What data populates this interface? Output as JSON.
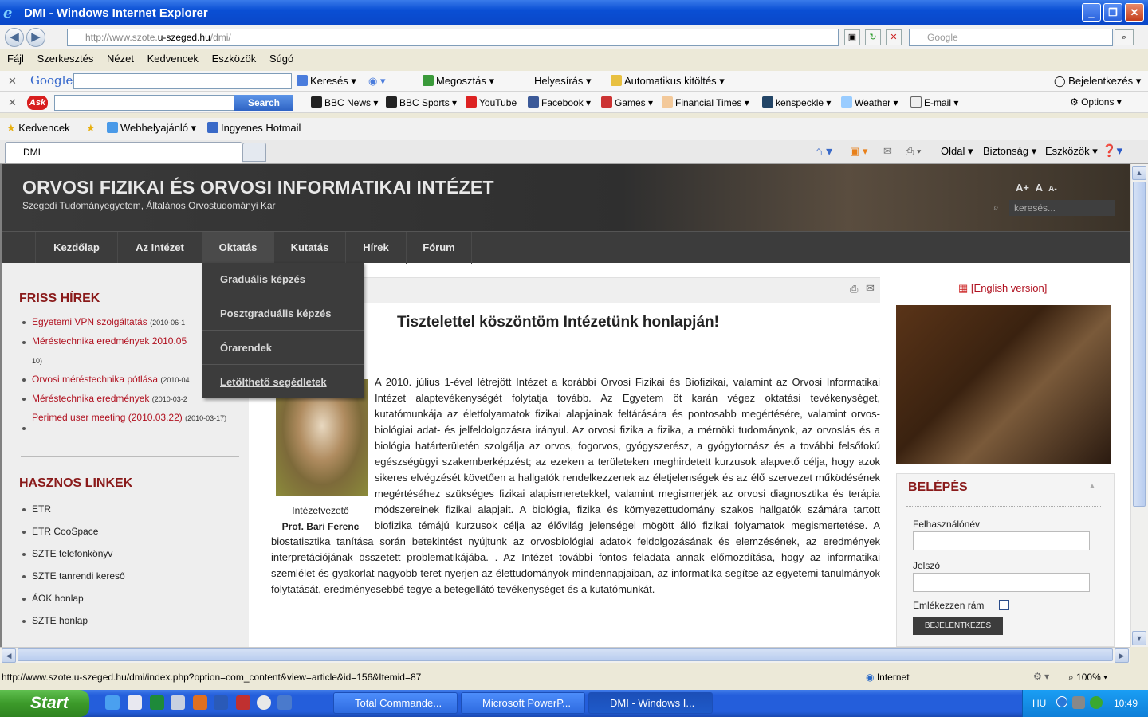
{
  "window": {
    "title": "DMI - Windows Internet Explorer"
  },
  "address": {
    "url_prefix": "http://www.szote.",
    "url_domain": "u-szeged.hu",
    "url_suffix": "/dmi/",
    "search_placeholder": "Google"
  },
  "menu": [
    "Fájl",
    "Szerkesztés",
    "Nézet",
    "Kedvencek",
    "Eszközök",
    "Súgó"
  ],
  "google_toolbar": {
    "logo": "Google",
    "items": [
      "Keresés",
      "Megosztás",
      "Helyesírás",
      "Automatikus kitöltés",
      "Bejelentkezés"
    ]
  },
  "ask_toolbar": {
    "logo": "Ask",
    "search_button": "Search",
    "items": [
      "BBC News",
      "BBC Sports",
      "YouTube",
      "Facebook",
      "Games",
      "Financial Times",
      "kenspeckle",
      "Weather",
      "E-mail",
      "Options"
    ]
  },
  "favorites": {
    "label": "Kedvencek",
    "items": [
      "Webhelyajánló",
      "Ingyenes Hotmail"
    ]
  },
  "tabs": {
    "active": "DMI",
    "commands": [
      "Oldal",
      "Biztonság",
      "Eszközök"
    ]
  },
  "site": {
    "title": "ORVOSI FIZIKAI ÉS ORVOSI INFORMATIKAI INTÉZET",
    "subtitle": "Szegedi Tudományegyetem, Általános Orvostudományi Kar",
    "font_sizes": [
      "A+",
      "A",
      "A-"
    ],
    "search_placeholder": "keresés...",
    "nav": [
      "Kezdőlap",
      "Az Intézet",
      "Oktatás",
      "Kutatás",
      "Hírek",
      "Fórum"
    ],
    "dropdown": [
      "Graduális képzés",
      "Posztgraduális képzés",
      "Órarendek",
      "Letölthető segédletek"
    ]
  },
  "news": {
    "heading": "FRISS HÍREK",
    "items": [
      {
        "title": "Egyetemi VPN szolgáltatás",
        "date": "(2010-06-1"
      },
      {
        "title": "Méréstechnika eredmények 2010.05",
        "date": "10)"
      },
      {
        "title": "Orvosi méréstechnika pótlása",
        "date": "(2010-04"
      },
      {
        "title": "Méréstechnika eredmények",
        "date": "(2010-03-2"
      },
      {
        "title": "Perimed user meeting (2010.03.22)",
        "date": "(2010-03-17)"
      }
    ]
  },
  "links": {
    "heading": "HASZNOS LINKEK",
    "items": [
      "ETR",
      "ETR CooSpace",
      "SZTE telefonkönyv",
      "SZTE tanrendi kereső",
      "ÁOK honlap",
      "SZTE honlap"
    ]
  },
  "article": {
    "heading": "Tisztelettel köszöntöm Intézetünk honlapján!",
    "caption_role": "Intézetvezető",
    "caption_name": "Prof. Bari Ferenc",
    "body": "A 2010. július 1-ével létrejött Intézet a korábbi Orvosi Fizikai és Biofizikai, valamint az Orvosi Informatikai Intézet alaptevékenységét folytatja tovább. Az Egyetem öt karán végez oktatási tevékenységet, kutatómunkája az életfolyamatok fizikai alapjainak feltárására és pontosabb megértésére, valamint orvos-biológiai adat- és jelfeldolgozásra irányul. Az orvosi fizika a fizika, a mérnöki tudományok, az orvoslás és a biológia határterületén szolgálja az orvos, fogorvos, gyógyszerész, a gyógytornász és a további felsőfokú egészségügyi szakemberképzést; az ezeken a területeken meghirdetett kurzusok alapvető célja, hogy azok sikeres elvégzését követően a hallgatók rendelkezzenek az életjelenségek és az élő szervezet működésének megértéséhez szükséges fizikai alapismeretekkel, valamint megismerjék az orvosi diagnosztika és terápia módszereinek fizikai alapjait. A biológia, fizika és környezettudomány szakos hallgatók számára tartott biofizika témájú kurzusok célja az élővilág jelenségei mögött álló fizikai folyamatok megismertetése. A biostatisztika tanítása során betekintést nyújtunk az orvosbiológiai adatok feldolgozásának és elemzésének, az eredmények interpretációjának összetett problematikájába. . Az Intézet további fontos feladata annak előmozdítása, hogy az informatikai szemlélet és gyakorlat nagyobb teret nyerjen az élettudományok mindennapjaiban, az informatika segítse az egyetemi tanulmányok folytatását, eredményesebbé tegye a betegellátó tevékenységet és a kutatómunkát."
  },
  "english": "[English version]",
  "login": {
    "title": "BELÉPÉS",
    "user_label": "Felhasználónév",
    "pass_label": "Jelszó",
    "remember_label": "Emlékezzen rám",
    "button": "BEJELENTKEZÉS"
  },
  "status": {
    "url": "http://www.szote.u-szeged.hu/dmi/index.php?option=com_content&view=article&id=156&Itemid=87",
    "zone": "Internet",
    "zoom": "100%"
  },
  "taskbar": {
    "start": "Start",
    "tasks": [
      "Total Commande...",
      "Microsoft PowerP...",
      "DMI - Windows I..."
    ],
    "lang": "HU",
    "time": "10:49"
  }
}
